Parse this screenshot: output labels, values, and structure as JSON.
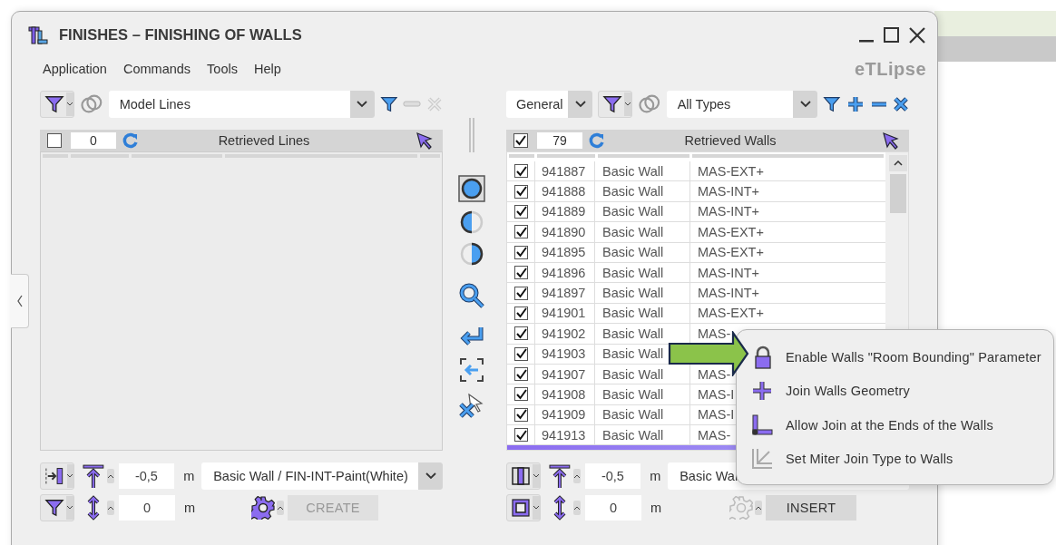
{
  "window": {
    "title": "FINISHES – FINISHING OF WALLS",
    "logo": "eTLipse"
  },
  "menu": [
    "Application",
    "Commands",
    "Tools",
    "Help"
  ],
  "left_panel": {
    "type_combo": "Model Lines",
    "header": {
      "checked": false,
      "count": "0",
      "title": "Retrieved Lines"
    },
    "offset": {
      "value": "-0,5",
      "unit": "m"
    },
    "height": {
      "value": "0",
      "unit": "m"
    },
    "wall_type": "Basic Wall / FIN-INT-Paint(White)",
    "create_button": {
      "label": "CREATE",
      "disabled": true
    }
  },
  "right_panel": {
    "category": "General",
    "type_combo": "All Types",
    "header": {
      "checked": true,
      "count": "79",
      "title": "Retrieved Walls"
    },
    "rows": [
      {
        "checked": true,
        "id": "941887",
        "family": "Basic Wall",
        "type": "MAS-EXT+"
      },
      {
        "checked": true,
        "id": "941888",
        "family": "Basic Wall",
        "type": "MAS-INT+"
      },
      {
        "checked": true,
        "id": "941889",
        "family": "Basic Wall",
        "type": "MAS-INT+"
      },
      {
        "checked": true,
        "id": "941890",
        "family": "Basic Wall",
        "type": "MAS-EXT+"
      },
      {
        "checked": true,
        "id": "941895",
        "family": "Basic Wall",
        "type": "MAS-EXT+"
      },
      {
        "checked": true,
        "id": "941896",
        "family": "Basic Wall",
        "type": "MAS-INT+"
      },
      {
        "checked": true,
        "id": "941897",
        "family": "Basic Wall",
        "type": "MAS-INT+"
      },
      {
        "checked": true,
        "id": "941901",
        "family": "Basic Wall",
        "type": "MAS-EXT+"
      },
      {
        "checked": true,
        "id": "941902",
        "family": "Basic Wall",
        "type": "MAS-"
      },
      {
        "checked": true,
        "id": "941903",
        "family": "Basic Wall"
      },
      {
        "checked": true,
        "id": "941907",
        "family": "Basic Wall",
        "type": "MAS-"
      },
      {
        "checked": true,
        "id": "941908",
        "family": "Basic Wall",
        "type": "MAS-I"
      },
      {
        "checked": true,
        "id": "941909",
        "family": "Basic Wall",
        "type": "MAS-I"
      },
      {
        "checked": true,
        "id": "941913",
        "family": "Basic Wall",
        "type": "MAS-"
      }
    ],
    "offset": {
      "value": "-0,5",
      "unit": "m"
    },
    "height": {
      "value": "0",
      "unit": "m"
    },
    "wall_type": "Basic Wal",
    "insert_button": {
      "label": "INSERT",
      "disabled": false
    }
  },
  "context_menu": [
    {
      "kind": "lock",
      "label": "Enable Walls \"Room Bounding\" Parameter"
    },
    {
      "kind": "plus",
      "label": "Join Walls Geometry"
    },
    {
      "kind": "corner",
      "label": "Allow Join at the Ends of the Walls"
    },
    {
      "kind": "miter",
      "label": "Set Miter Join Type to Walls"
    }
  ]
}
